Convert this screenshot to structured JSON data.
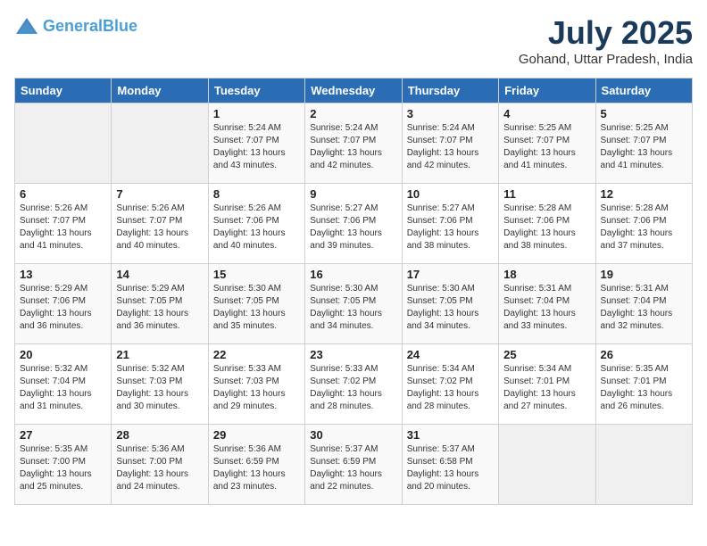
{
  "header": {
    "logo_line1": "General",
    "logo_line2": "Blue",
    "month_title": "July 2025",
    "location": "Gohand, Uttar Pradesh, India"
  },
  "weekdays": [
    "Sunday",
    "Monday",
    "Tuesday",
    "Wednesday",
    "Thursday",
    "Friday",
    "Saturday"
  ],
  "weeks": [
    [
      {
        "day": "",
        "info": ""
      },
      {
        "day": "",
        "info": ""
      },
      {
        "day": "1",
        "info": "Sunrise: 5:24 AM\nSunset: 7:07 PM\nDaylight: 13 hours and 43 minutes."
      },
      {
        "day": "2",
        "info": "Sunrise: 5:24 AM\nSunset: 7:07 PM\nDaylight: 13 hours and 42 minutes."
      },
      {
        "day": "3",
        "info": "Sunrise: 5:24 AM\nSunset: 7:07 PM\nDaylight: 13 hours and 42 minutes."
      },
      {
        "day": "4",
        "info": "Sunrise: 5:25 AM\nSunset: 7:07 PM\nDaylight: 13 hours and 41 minutes."
      },
      {
        "day": "5",
        "info": "Sunrise: 5:25 AM\nSunset: 7:07 PM\nDaylight: 13 hours and 41 minutes."
      }
    ],
    [
      {
        "day": "6",
        "info": "Sunrise: 5:26 AM\nSunset: 7:07 PM\nDaylight: 13 hours and 41 minutes."
      },
      {
        "day": "7",
        "info": "Sunrise: 5:26 AM\nSunset: 7:07 PM\nDaylight: 13 hours and 40 minutes."
      },
      {
        "day": "8",
        "info": "Sunrise: 5:26 AM\nSunset: 7:06 PM\nDaylight: 13 hours and 40 minutes."
      },
      {
        "day": "9",
        "info": "Sunrise: 5:27 AM\nSunset: 7:06 PM\nDaylight: 13 hours and 39 minutes."
      },
      {
        "day": "10",
        "info": "Sunrise: 5:27 AM\nSunset: 7:06 PM\nDaylight: 13 hours and 38 minutes."
      },
      {
        "day": "11",
        "info": "Sunrise: 5:28 AM\nSunset: 7:06 PM\nDaylight: 13 hours and 38 minutes."
      },
      {
        "day": "12",
        "info": "Sunrise: 5:28 AM\nSunset: 7:06 PM\nDaylight: 13 hours and 37 minutes."
      }
    ],
    [
      {
        "day": "13",
        "info": "Sunrise: 5:29 AM\nSunset: 7:06 PM\nDaylight: 13 hours and 36 minutes."
      },
      {
        "day": "14",
        "info": "Sunrise: 5:29 AM\nSunset: 7:05 PM\nDaylight: 13 hours and 36 minutes."
      },
      {
        "day": "15",
        "info": "Sunrise: 5:30 AM\nSunset: 7:05 PM\nDaylight: 13 hours and 35 minutes."
      },
      {
        "day": "16",
        "info": "Sunrise: 5:30 AM\nSunset: 7:05 PM\nDaylight: 13 hours and 34 minutes."
      },
      {
        "day": "17",
        "info": "Sunrise: 5:30 AM\nSunset: 7:05 PM\nDaylight: 13 hours and 34 minutes."
      },
      {
        "day": "18",
        "info": "Sunrise: 5:31 AM\nSunset: 7:04 PM\nDaylight: 13 hours and 33 minutes."
      },
      {
        "day": "19",
        "info": "Sunrise: 5:31 AM\nSunset: 7:04 PM\nDaylight: 13 hours and 32 minutes."
      }
    ],
    [
      {
        "day": "20",
        "info": "Sunrise: 5:32 AM\nSunset: 7:04 PM\nDaylight: 13 hours and 31 minutes."
      },
      {
        "day": "21",
        "info": "Sunrise: 5:32 AM\nSunset: 7:03 PM\nDaylight: 13 hours and 30 minutes."
      },
      {
        "day": "22",
        "info": "Sunrise: 5:33 AM\nSunset: 7:03 PM\nDaylight: 13 hours and 29 minutes."
      },
      {
        "day": "23",
        "info": "Sunrise: 5:33 AM\nSunset: 7:02 PM\nDaylight: 13 hours and 28 minutes."
      },
      {
        "day": "24",
        "info": "Sunrise: 5:34 AM\nSunset: 7:02 PM\nDaylight: 13 hours and 28 minutes."
      },
      {
        "day": "25",
        "info": "Sunrise: 5:34 AM\nSunset: 7:01 PM\nDaylight: 13 hours and 27 minutes."
      },
      {
        "day": "26",
        "info": "Sunrise: 5:35 AM\nSunset: 7:01 PM\nDaylight: 13 hours and 26 minutes."
      }
    ],
    [
      {
        "day": "27",
        "info": "Sunrise: 5:35 AM\nSunset: 7:00 PM\nDaylight: 13 hours and 25 minutes."
      },
      {
        "day": "28",
        "info": "Sunrise: 5:36 AM\nSunset: 7:00 PM\nDaylight: 13 hours and 24 minutes."
      },
      {
        "day": "29",
        "info": "Sunrise: 5:36 AM\nSunset: 6:59 PM\nDaylight: 13 hours and 23 minutes."
      },
      {
        "day": "30",
        "info": "Sunrise: 5:37 AM\nSunset: 6:59 PM\nDaylight: 13 hours and 22 minutes."
      },
      {
        "day": "31",
        "info": "Sunrise: 5:37 AM\nSunset: 6:58 PM\nDaylight: 13 hours and 20 minutes."
      },
      {
        "day": "",
        "info": ""
      },
      {
        "day": "",
        "info": ""
      }
    ]
  ]
}
